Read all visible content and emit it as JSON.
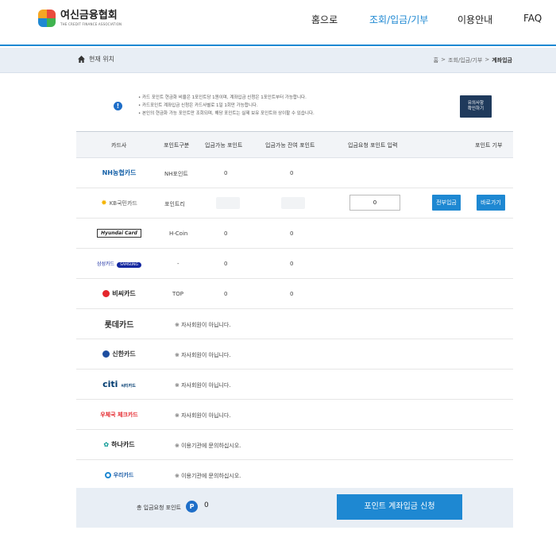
{
  "header": {
    "logo_ko": "여신금융협회",
    "logo_en": "THE CREDIT FINANCE ASSOCIATION",
    "nav": {
      "home": "홈으로",
      "query": "조회/입금/기부",
      "guide": "이용안내",
      "faq": "FAQ"
    },
    "accent_color": "#1e88d2"
  },
  "breadcrumb": {
    "location_label": "현재 위치",
    "path": [
      "홈",
      ">",
      "조회/입금/기부",
      ">",
      "계좌입금"
    ]
  },
  "notice": {
    "lines": [
      "• 카드 포인트 현금화 비율은 1포인트당 1원이며, 계좌입금 신청은 1포인트부터 가능합니다.",
      "• 카드포인트 계좌입금 신청은 카드사별로 1일 1회만 가능합니다.",
      "• 본인의 현금화 가능 포인트만 조회되며, 해당 포인트는 실제 보유 포인트와 상이할 수 있습니다."
    ],
    "button_line1": "유의사항",
    "button_line2": "확인하기"
  },
  "table": {
    "headers": {
      "card": "카드사",
      "point_type": "포인트구분",
      "available": "입금가능 포인트",
      "remaining": "입금가능 잔여 포인트",
      "request": "입금요청 포인트 입력",
      "donate": "포인트 기부"
    },
    "rows": [
      {
        "card": "NH농협카드",
        "point_type": "NH포인트",
        "available": "0",
        "remaining": "0"
      },
      {
        "card": "KB국민카드",
        "point_type": "포인트리",
        "request_value": "0",
        "deposit_all_label": "전부입금",
        "goto_label": "바로가기"
      },
      {
        "card": "Hyundai Card",
        "point_type": "H-Coin",
        "available": "0",
        "remaining": "0"
      },
      {
        "card": "삼성카드",
        "card_sub": "SAMSUNG",
        "point_type": "-",
        "available": "0",
        "remaining": "0"
      },
      {
        "card": "비씨카드",
        "point_type": "TOP",
        "available": "0",
        "remaining": "0"
      },
      {
        "card": "롯데카드",
        "message": "※ 자사회원이 아닙니다."
      },
      {
        "card": "신한카드",
        "message": "※ 자사회원이 아닙니다."
      },
      {
        "card": "citi",
        "card_sub": "씨티카드",
        "message": "※ 자사회원이 아닙니다."
      },
      {
        "card": "우체국 체크카드",
        "message": "※ 자사회원이 아닙니다."
      },
      {
        "card": "하나카드",
        "message": "※ 이용기관에 문의하십시오."
      },
      {
        "card": "우리카드",
        "message": "※ 이용기관에 문의하십시오."
      }
    ]
  },
  "footer": {
    "total_label": "총 입금요청 포인트",
    "badge": "P",
    "total_value": "0",
    "submit_label": "포인트 계좌입금 신청"
  }
}
